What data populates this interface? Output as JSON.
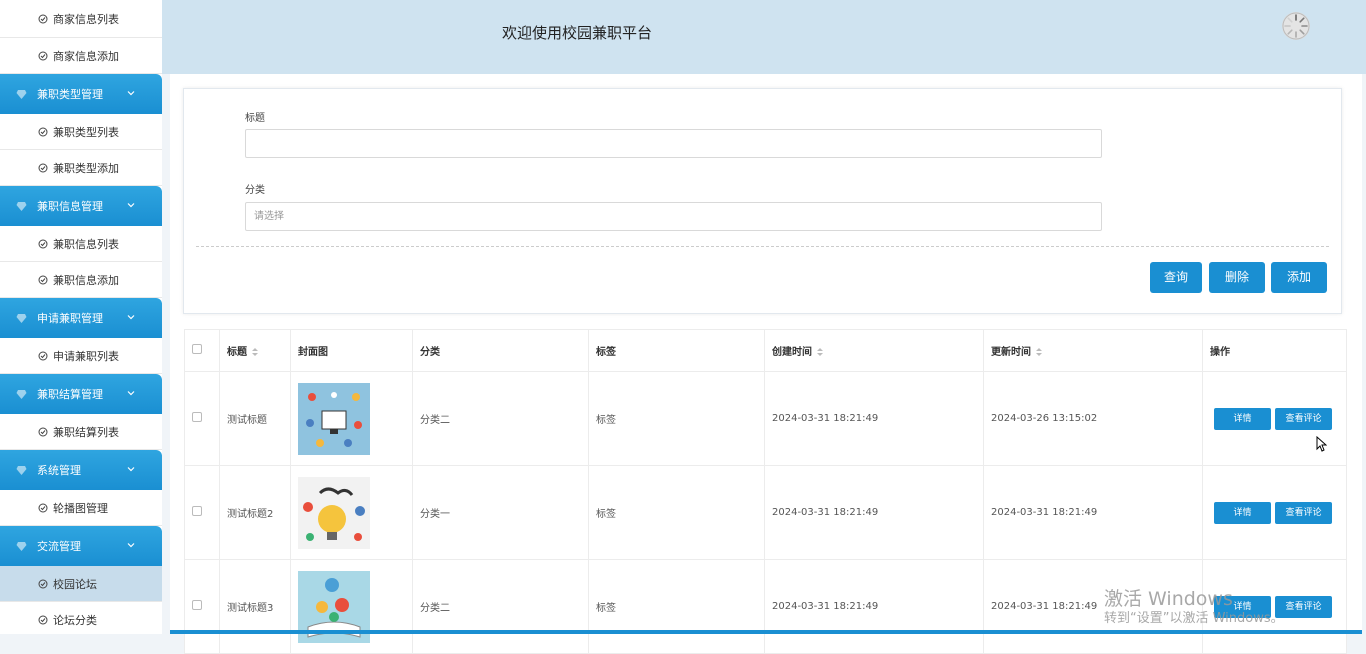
{
  "sidebar": {
    "groups": [
      {
        "items": [
          "商家信息列表",
          "商家信息添加"
        ]
      },
      {
        "title": "兼职类型管理",
        "items": [
          "兼职类型列表",
          "兼职类型添加"
        ]
      },
      {
        "title": "兼职信息管理",
        "items": [
          "兼职信息列表",
          "兼职信息添加"
        ]
      },
      {
        "title": "申请兼职管理",
        "items": [
          "申请兼职列表"
        ]
      },
      {
        "title": "兼职结算管理",
        "items": [
          "兼职结算列表"
        ]
      },
      {
        "title": "系统管理",
        "items": [
          "轮播图管理"
        ]
      },
      {
        "title": "交流管理",
        "items": [
          "校园论坛",
          "论坛分类"
        ]
      }
    ],
    "active_item": "校园论坛"
  },
  "header": {
    "title": "欢迎使用校园兼职平台"
  },
  "search": {
    "title_label": "标题",
    "title_value": "",
    "category_label": "分类",
    "category_placeholder": "请选择",
    "query_button": "查询",
    "delete_button": "删除",
    "add_button": "添加"
  },
  "table": {
    "headers": [
      "标题",
      "封面图",
      "分类",
      "标签",
      "创建时间",
      "更新时间",
      "操作"
    ],
    "rows": [
      {
        "title": "测试标题",
        "category": "分类二",
        "tag": "标签",
        "created": "2024-03-31 18:21:49",
        "updated": "2024-03-26 13:15:02"
      },
      {
        "title": "测试标题2",
        "category": "分类一",
        "tag": "标签",
        "created": "2024-03-31 18:21:49",
        "updated": "2024-03-31 18:21:49"
      },
      {
        "title": "测试标题3",
        "category": "分类二",
        "tag": "标签",
        "created": "2024-03-31 18:21:49",
        "updated": "2024-03-31 18:21:49"
      }
    ],
    "detail_button": "详情",
    "comment_button": "查看评论"
  },
  "watermark": {
    "line1": "激活 Windows",
    "line2": "转到“设置”以激活 Windows。"
  },
  "colors": {
    "accent": "#1a8fd2",
    "header_bg": "#cfe3f0",
    "active_item_bg": "#c7dceb"
  }
}
